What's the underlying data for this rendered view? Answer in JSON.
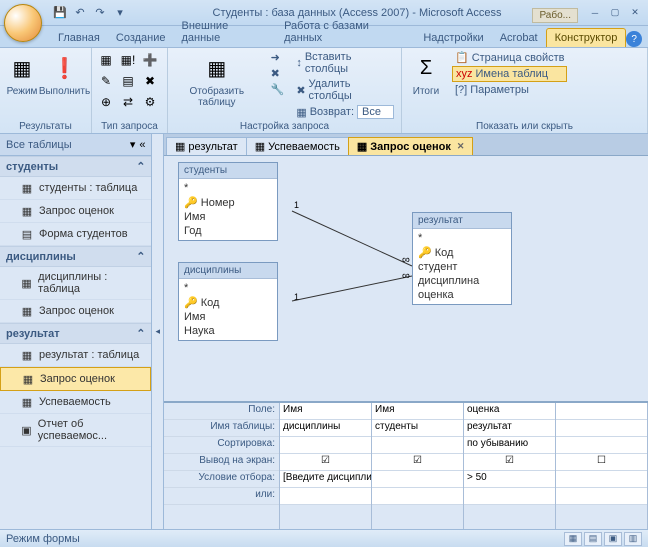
{
  "title": "Студенты : база данных (Access 2007) - Microsoft Access",
  "extra_tab": "Рабо...",
  "tabs": {
    "home": "Главная",
    "create": "Создание",
    "ext": "Внешние данные",
    "dbtools": "Работа с базами данных",
    "addins": "Надстройки",
    "acrobat": "Acrobat",
    "design": "Конструктор"
  },
  "ribbon": {
    "results": {
      "label": "Результаты",
      "view": "Режим",
      "run": "Выполнить"
    },
    "qtype": {
      "label": "Тип запроса"
    },
    "setup": {
      "label": "Настройка запроса",
      "showtable": "Отобразить таблицу",
      "insertcol": "Вставить столбцы",
      "deletecol": "Удалить столбцы",
      "return": "Возврат:",
      "return_val": "Все"
    },
    "showhide": {
      "label": "Показать или скрыть",
      "totals": "Итоги",
      "propsheet": "Страница свойств",
      "tablenames": "Имена таблиц",
      "params": "Параметры"
    }
  },
  "nav": {
    "header": "Все таблицы",
    "groups": [
      {
        "name": "студенты",
        "items": [
          {
            "icon": "▦",
            "label": "студенты : таблица"
          },
          {
            "icon": "▦",
            "label": "Запрос оценок"
          },
          {
            "icon": "▤",
            "label": "Форма студентов"
          }
        ]
      },
      {
        "name": "дисциплины",
        "items": [
          {
            "icon": "▦",
            "label": "дисциплины : таблица"
          },
          {
            "icon": "▦",
            "label": "Запрос оценок"
          }
        ]
      },
      {
        "name": "результат",
        "items": [
          {
            "icon": "▦",
            "label": "результат : таблица"
          },
          {
            "icon": "▦",
            "label": "Запрос оценок",
            "sel": true
          },
          {
            "icon": "▦",
            "label": "Успеваемость"
          },
          {
            "icon": "▣",
            "label": "Отчет об успеваемос..."
          }
        ]
      }
    ]
  },
  "doctabs": [
    {
      "icon": "▦",
      "label": "результат"
    },
    {
      "icon": "▦",
      "label": "Успеваемость"
    },
    {
      "icon": "▦",
      "label": "Запрос оценок",
      "active": true
    }
  ],
  "tables": {
    "t1": {
      "title": "студенты",
      "fields": [
        "*",
        "Номер",
        "Имя",
        "Год"
      ],
      "key": 1
    },
    "t2": {
      "title": "дисциплины",
      "fields": [
        "*",
        "Код",
        "Имя",
        "Наука"
      ],
      "key": 1
    },
    "t3": {
      "title": "результат",
      "fields": [
        "*",
        "Код",
        "студент",
        "дисциплина",
        "оценка"
      ],
      "key": 1
    }
  },
  "grid": {
    "labels": [
      "Поле:",
      "Имя таблицы:",
      "Сортировка:",
      "Вывод на экран:",
      "Условие отбора:",
      "или:"
    ],
    "cols": [
      {
        "field": "Имя",
        "table": "дисциплины",
        "sort": "",
        "show": true,
        "crit": "[Введите дисциплину]",
        "or": ""
      },
      {
        "field": "Имя",
        "table": "студенты",
        "sort": "",
        "show": true,
        "crit": "",
        "or": ""
      },
      {
        "field": "оценка",
        "table": "результат",
        "sort": "по убыванию",
        "show": true,
        "crit": "> 50",
        "or": ""
      }
    ]
  },
  "status": "Режим формы",
  "joins": {
    "one": "1",
    "inf": "∞"
  }
}
